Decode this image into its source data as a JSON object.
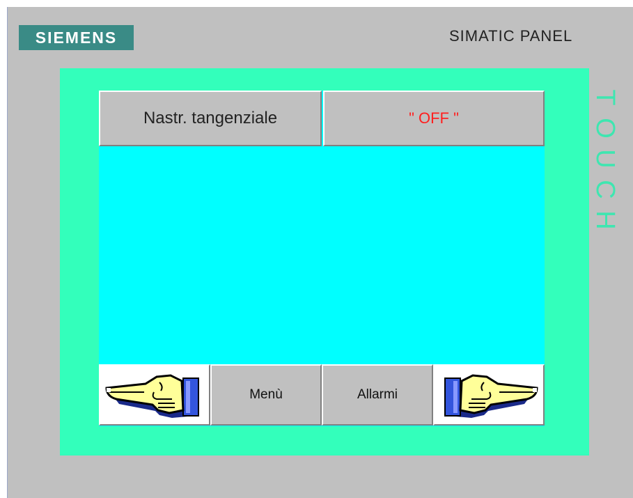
{
  "brand": {
    "logo_text": "SIEMENS",
    "panel_title": "SIMATIC PANEL",
    "side_label": "TOUCH"
  },
  "header": {
    "name": "Nastr. tangenziale",
    "status": "\" OFF \""
  },
  "nav": {
    "prev_icon": "hand-pointing-left-icon",
    "menu_label": "Menù",
    "alarms_label": "Allarmi",
    "next_icon": "hand-pointing-right-icon"
  },
  "colors": {
    "bezel": "#33ffbb",
    "screen": "#00ffff",
    "status_off": "#ff2020",
    "logo_bg": "#3a8b86"
  }
}
